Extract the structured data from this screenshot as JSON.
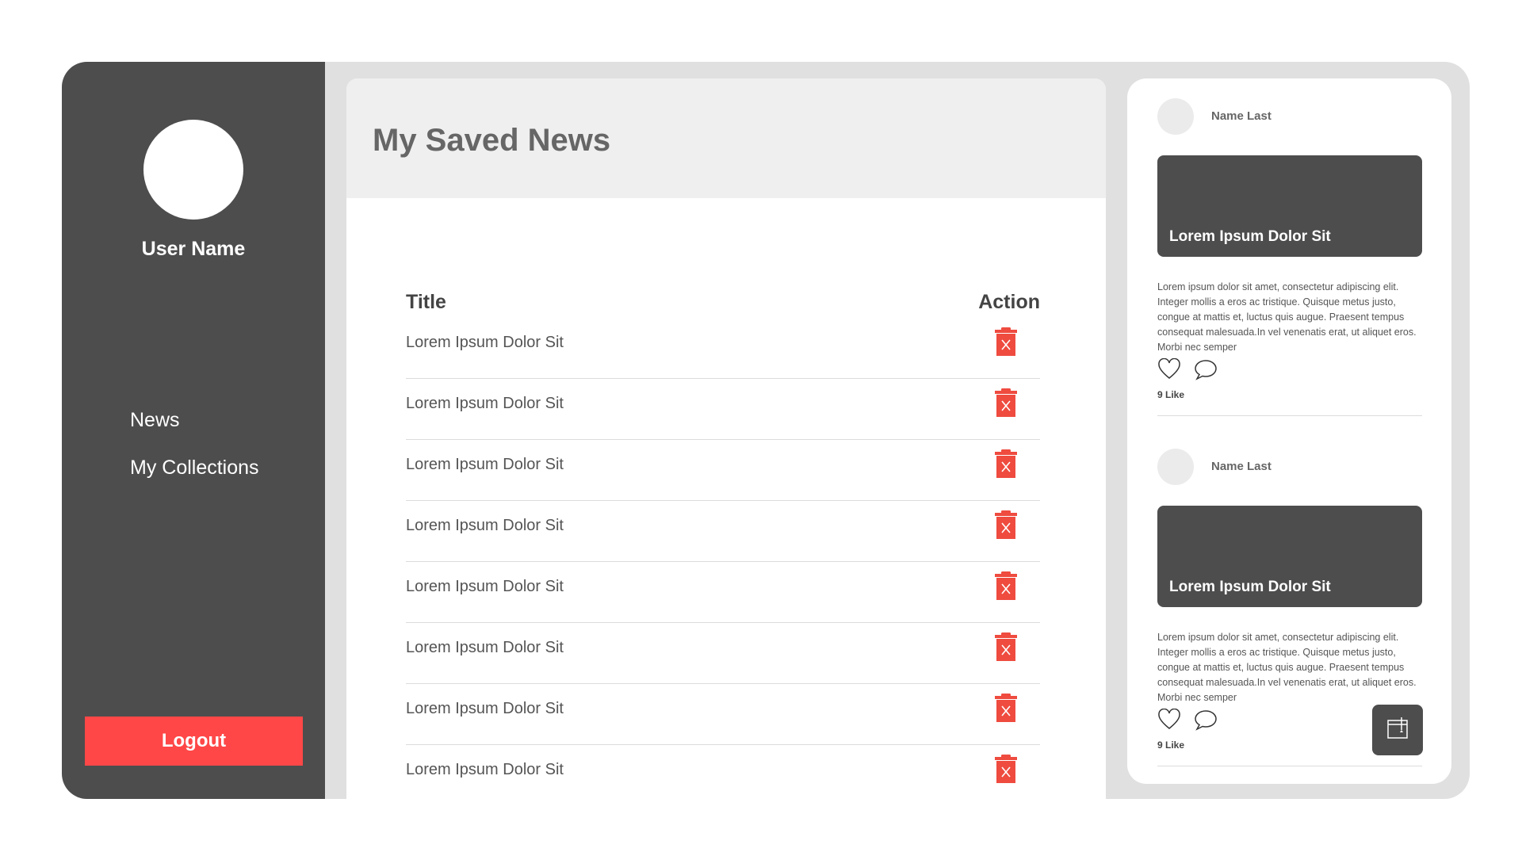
{
  "sidebar": {
    "user_name": "User Name",
    "nav": [
      {
        "label": "News"
      },
      {
        "label": "My Collections"
      }
    ],
    "logout_label": "Logout"
  },
  "main": {
    "title": "My Saved News",
    "table": {
      "headers": {
        "title": "Title",
        "action": "Action"
      },
      "rows": [
        {
          "title": "Lorem Ipsum Dolor Sit",
          "action_icon": "trash-icon"
        },
        {
          "title": "Lorem Ipsum Dolor Sit",
          "action_icon": "trash-icon"
        },
        {
          "title": "Lorem Ipsum Dolor Sit",
          "action_icon": "trash-icon"
        },
        {
          "title": "Lorem Ipsum Dolor Sit",
          "action_icon": "trash-icon"
        },
        {
          "title": "Lorem Ipsum Dolor Sit",
          "action_icon": "trash-icon"
        },
        {
          "title": "Lorem Ipsum Dolor Sit",
          "action_icon": "trash-icon"
        },
        {
          "title": "Lorem Ipsum Dolor Sit",
          "action_icon": "trash-icon"
        },
        {
          "title": "Lorem Ipsum Dolor Sit",
          "action_icon": "trash-icon"
        }
      ]
    }
  },
  "feed": {
    "posts": [
      {
        "author": "Name Last",
        "card_title": "Lorem Ipsum Dolor Sit",
        "body": "Lorem ipsum dolor sit amet, consectetur adipiscing elit. Integer mollis a eros ac tristique. Quisque metus justo, congue at mattis et, luctus quis augue. Praesent tempus consequat malesuada.In vel venenatis erat, ut aliquet eros. Morbi nec semper",
        "likes": "9 Like"
      },
      {
        "author": "Name Last",
        "card_title": "Lorem Ipsum Dolor Sit",
        "body": "Lorem ipsum dolor sit amet, consectetur adipiscing elit. Integer mollis a eros ac tristique. Quisque metus justo, congue at mattis et, luctus quis augue. Praesent tempus consequat malesuada.In vel venenatis erat, ut aliquet eros. Morbi nec semper",
        "likes": "9 Like"
      }
    ],
    "fab_icon": "notebook-icon"
  },
  "colors": {
    "sidebar_bg": "#4d4d4d",
    "logout_bg": "#ff4747",
    "trash_red": "#ef4b3f",
    "frame_bg": "#e0e0e0",
    "header_bg": "#efefef"
  }
}
